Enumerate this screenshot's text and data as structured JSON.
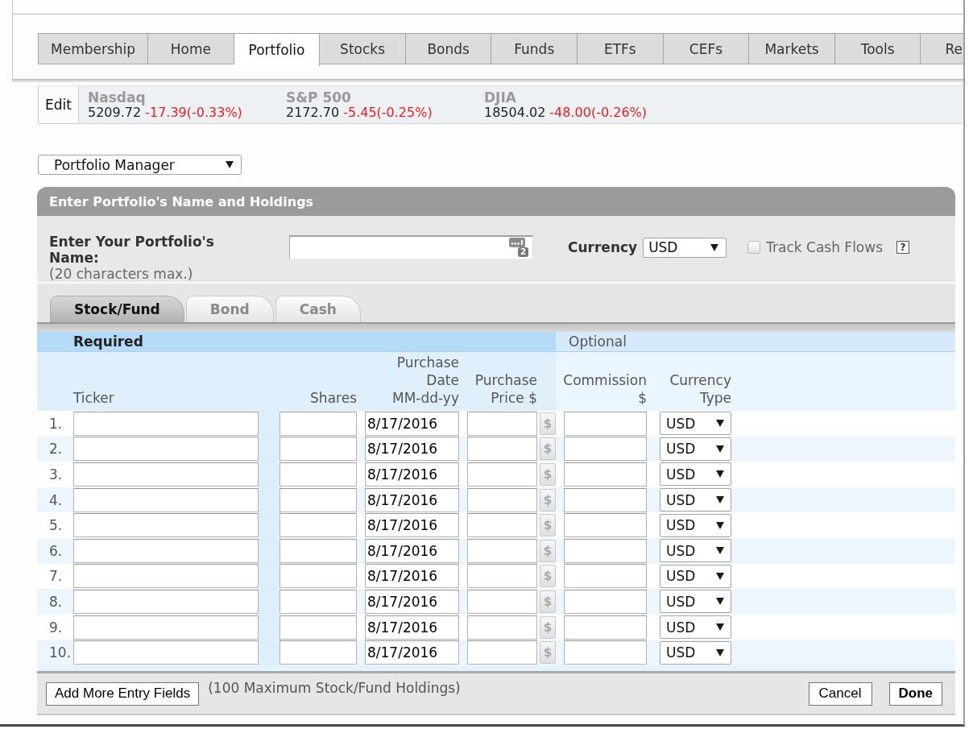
{
  "nav_tabs": [
    {
      "label": "Membership",
      "selected": false
    },
    {
      "label": "Home",
      "selected": false
    },
    {
      "label": "Portfolio",
      "selected": true
    },
    {
      "label": "Stocks",
      "selected": false
    },
    {
      "label": "Bonds",
      "selected": false
    },
    {
      "label": "Funds",
      "selected": false
    },
    {
      "label": "ETFs",
      "selected": false
    },
    {
      "label": "CEFs",
      "selected": false
    },
    {
      "label": "Markets",
      "selected": false
    },
    {
      "label": "Tools",
      "selected": false
    },
    {
      "label": "Re",
      "selected": false
    }
  ],
  "market_bar": {
    "edit_button": "Edit",
    "indices": [
      {
        "name": "Nasdaq",
        "value": "5209.72",
        "change": "-17.39(-0.33%)"
      },
      {
        "name": "S&P 500",
        "value": "2172.70",
        "change": "-5.45(-0.25%)"
      },
      {
        "name": "DJIA",
        "value": "18504.02",
        "change": "-48.00(-0.26%)"
      }
    ]
  },
  "page_menu": {
    "value": "Portfolio Manager"
  },
  "panel": {
    "title": "Enter Portfolio's Name and Holdings",
    "portfolio_name": {
      "label": "Enter Your Portfolio's Name:",
      "hint": "(20 characters max.)",
      "badge": "2"
    },
    "currency": {
      "label": "Currency",
      "value": "USD"
    },
    "track_cash_flows": {
      "label": "Track Cash Flows",
      "checked": false
    },
    "help_button": "?",
    "tabs": [
      {
        "label": "Stock/Fund",
        "selected": true
      },
      {
        "label": "Bond",
        "selected": false
      },
      {
        "label": "Cash",
        "selected": false
      }
    ],
    "table": {
      "groups": [
        {
          "label": "Required",
          "kind": "required"
        },
        {
          "label": "Optional",
          "kind": "optional"
        }
      ],
      "columns": [
        "Ticker",
        "Shares",
        "Purchase Date MM-dd-yy",
        "Purchase Price $",
        "Commission $",
        "Currency Type"
      ],
      "rows": [
        {
          "number": "1.",
          "purchase_date": "8/17/2016",
          "price_button": "$",
          "currency": "USD"
        },
        {
          "number": "2.",
          "purchase_date": "8/17/2016",
          "price_button": "$",
          "currency": "USD"
        },
        {
          "number": "3.",
          "purchase_date": "8/17/2016",
          "price_button": "$",
          "currency": "USD"
        },
        {
          "number": "4.",
          "purchase_date": "8/17/2016",
          "price_button": "$",
          "currency": "USD"
        },
        {
          "number": "5.",
          "purchase_date": "8/17/2016",
          "price_button": "$",
          "currency": "USD"
        },
        {
          "number": "6.",
          "purchase_date": "8/17/2016",
          "price_button": "$",
          "currency": "USD"
        },
        {
          "number": "7.",
          "purchase_date": "8/17/2016",
          "price_button": "$",
          "currency": "USD"
        },
        {
          "number": "8.",
          "purchase_date": "8/17/2016",
          "price_button": "$",
          "currency": "USD"
        },
        {
          "number": "9.",
          "purchase_date": "8/17/2016",
          "price_button": "$",
          "currency": "USD"
        },
        {
          "number": "10.",
          "purchase_date": "8/17/2016",
          "price_button": "$",
          "currency": "USD"
        }
      ]
    },
    "footer": {
      "add_button": "Add More Entry Fields",
      "note": "(100 Maximum Stock/Fund Holdings)",
      "cancel_button": "Cancel",
      "done_button": "Done"
    }
  }
}
